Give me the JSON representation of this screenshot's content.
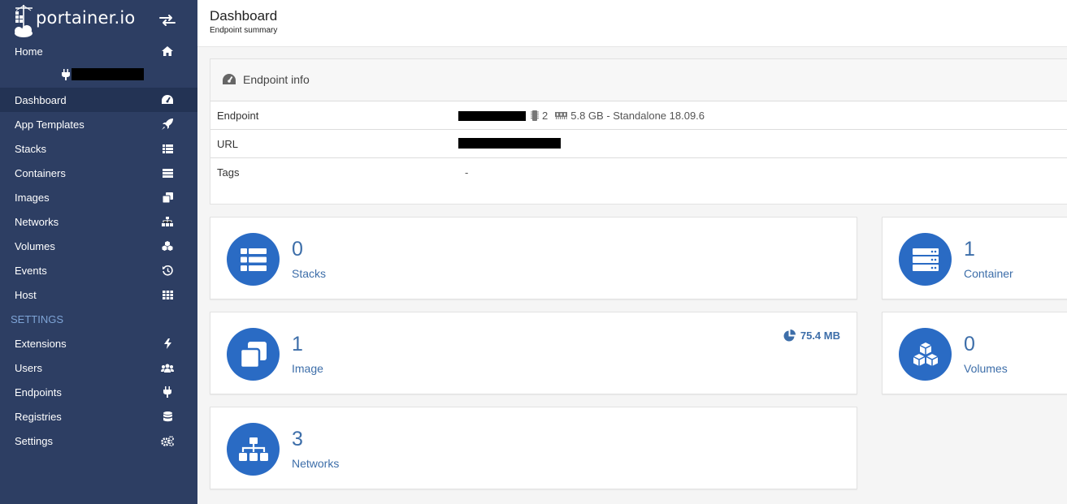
{
  "brand": {
    "logo_text": "portainer.io"
  },
  "sidebar": {
    "items": [
      {
        "label": "Home",
        "icon": "home-icon"
      },
      {
        "label": "Dashboard",
        "icon": "dashboard-icon"
      },
      {
        "label": "App Templates",
        "icon": "rocket-icon"
      },
      {
        "label": "Stacks",
        "icon": "th-list-icon"
      },
      {
        "label": "Containers",
        "icon": "server-icon"
      },
      {
        "label": "Images",
        "icon": "clone-icon"
      },
      {
        "label": "Networks",
        "icon": "sitemap-icon"
      },
      {
        "label": "Volumes",
        "icon": "cubes-icon"
      },
      {
        "label": "Events",
        "icon": "history-icon"
      },
      {
        "label": "Host",
        "icon": "th-icon"
      }
    ],
    "settings_header": "SETTINGS",
    "settings_items": [
      {
        "label": "Extensions",
        "icon": "bolt-icon"
      },
      {
        "label": "Users",
        "icon": "users-icon"
      },
      {
        "label": "Endpoints",
        "icon": "plug-icon"
      },
      {
        "label": "Registries",
        "icon": "database-icon"
      },
      {
        "label": "Settings",
        "icon": "cogs-icon"
      }
    ]
  },
  "header": {
    "title": "Dashboard",
    "subtitle": "Endpoint summary"
  },
  "endpoint_info": {
    "title": "Endpoint info",
    "rows": [
      {
        "key": "Endpoint",
        "cpu": "2",
        "memory": "5.8 GB - Standalone 18.09.6"
      },
      {
        "key": "URL"
      },
      {
        "key": "Tags",
        "value": "-"
      }
    ]
  },
  "tiles": {
    "stacks": {
      "count": "0",
      "label": "Stacks"
    },
    "container": {
      "count": "1",
      "label": "Container"
    },
    "image": {
      "count": "1",
      "label": "Image",
      "size": "75.4 MB"
    },
    "volumes": {
      "count": "0",
      "label": "Volumes"
    },
    "networks": {
      "count": "3",
      "label": "Networks"
    }
  },
  "colors": {
    "sidebar_bg": "#2d3e63",
    "sidebar_active": "#233354",
    "accent": "#2a6bc4",
    "accent_text": "#3d6ea9"
  }
}
